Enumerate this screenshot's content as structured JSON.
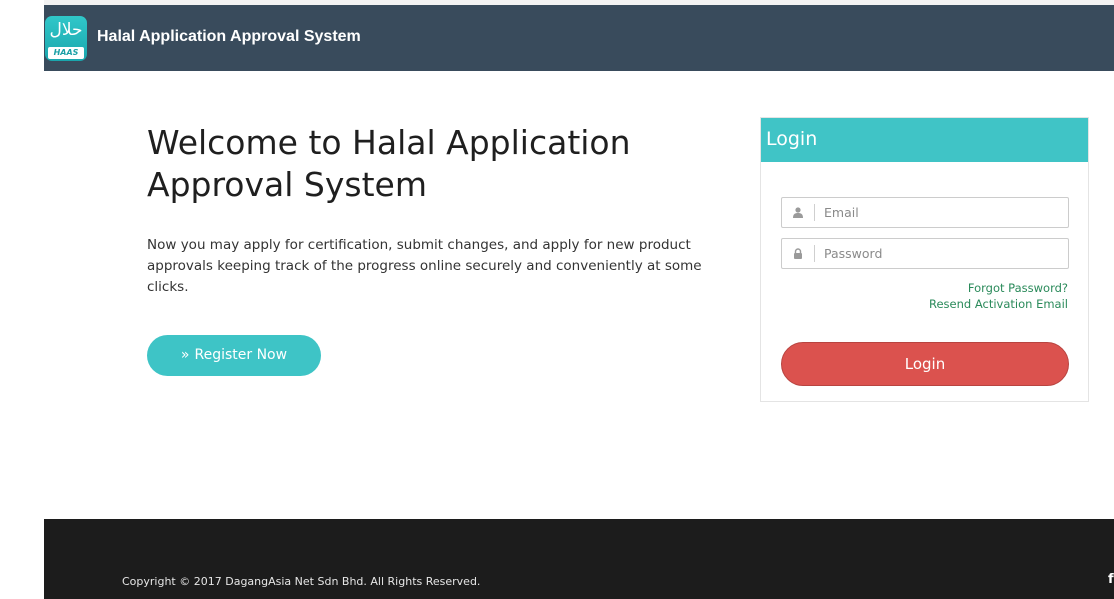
{
  "navbar": {
    "brand_title": "Halal Application Approval System",
    "logo_arabic": "حلال",
    "logo_badge": "HAAS"
  },
  "welcome": {
    "title": "Welcome to Halal Application Approval System",
    "description": "Now you may apply for certification, submit changes, and apply for new product approvals keeping track of the progress online securely and conveniently at some clicks.",
    "register_chevron": "»",
    "register_label": "Register Now"
  },
  "login": {
    "title": "Login",
    "email_placeholder": "Email",
    "email_icon": "user-icon",
    "password_placeholder": "Password",
    "password_icon": "lock-icon",
    "forgot_password": "Forgot Password?",
    "resend_activation": "Resend Activation Email",
    "submit_label": "Login"
  },
  "footer": {
    "copyright": "Copyright © 2017 DagangAsia Net Sdn Bhd. All Rights Reserved.",
    "social_icon": "facebook-icon",
    "social_glyph": "f"
  },
  "colors": {
    "navbar_bg": "#394b5c",
    "accent_teal": "#40c4c6",
    "login_button": "#db524e",
    "link_green": "#2a8a5a",
    "footer_bg": "#1c1c1c"
  }
}
